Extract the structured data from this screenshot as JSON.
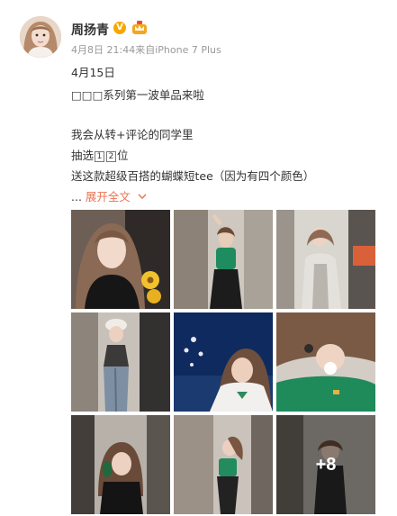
{
  "user": {
    "name": "周扬青",
    "verified_badge": "V"
  },
  "meta": {
    "timestamp": "4月8日 21:44",
    "source": "来自iPhone 7 Plus"
  },
  "post": {
    "line1": "4月15日",
    "line2": "□□□系列第一波单品来啦",
    "line3": "我会从转+评论的同学里",
    "line4_prefix": "抽选",
    "line4_n1": "1",
    "line4_n2": "2",
    "line4_suffix": "位",
    "line5": "送这款超级百搭的蝴蝶短tee（因为有四个颜色）",
    "ellipsis": "...",
    "expand_label": "展开全文",
    "expand_icon": "chevron-down-icon"
  },
  "photos": {
    "more_count": "+8",
    "count_shown": 9
  },
  "colors": {
    "accent": "#eb7350",
    "badge": "#f6a800"
  }
}
